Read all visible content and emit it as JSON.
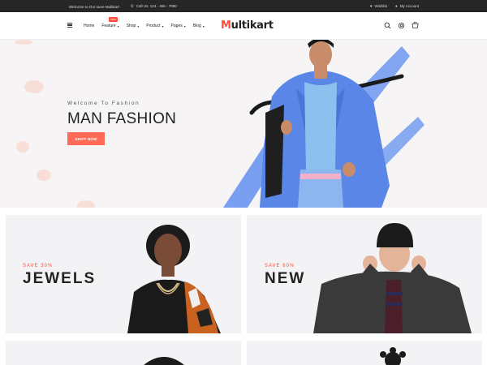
{
  "topbar": {
    "welcome": "Welcome to Our store Multikart",
    "call": "Call Us: 123 - 456 - 7890",
    "wishlist": "Wishlist",
    "account": "My Account"
  },
  "header": {
    "nav": [
      {
        "label": "Home",
        "dropdown": false
      },
      {
        "label": "Feature",
        "dropdown": true,
        "badge": "new"
      },
      {
        "label": "Shop",
        "dropdown": true
      },
      {
        "label": "Product",
        "dropdown": true
      },
      {
        "label": "Pages",
        "dropdown": true
      },
      {
        "label": "Blog",
        "dropdown": true
      }
    ],
    "logo": {
      "first": "M",
      "rest": "ultikart"
    },
    "icons": [
      "search-icon",
      "settings-icon",
      "cart-icon"
    ]
  },
  "hero": {
    "welcome": "Welcome To Fashion",
    "title": "MAN FASHION",
    "button": "SHOP NOW"
  },
  "banners": [
    {
      "save": "SAVE 30%",
      "title": "JEWELS"
    },
    {
      "save": "SAVE 60%",
      "title": "NEW"
    }
  ],
  "colors": {
    "accent": "#ff4c3b",
    "topbar": "#262626",
    "hero_bg": "#f6f4f4",
    "banner_bg": "#f3f3f5"
  }
}
